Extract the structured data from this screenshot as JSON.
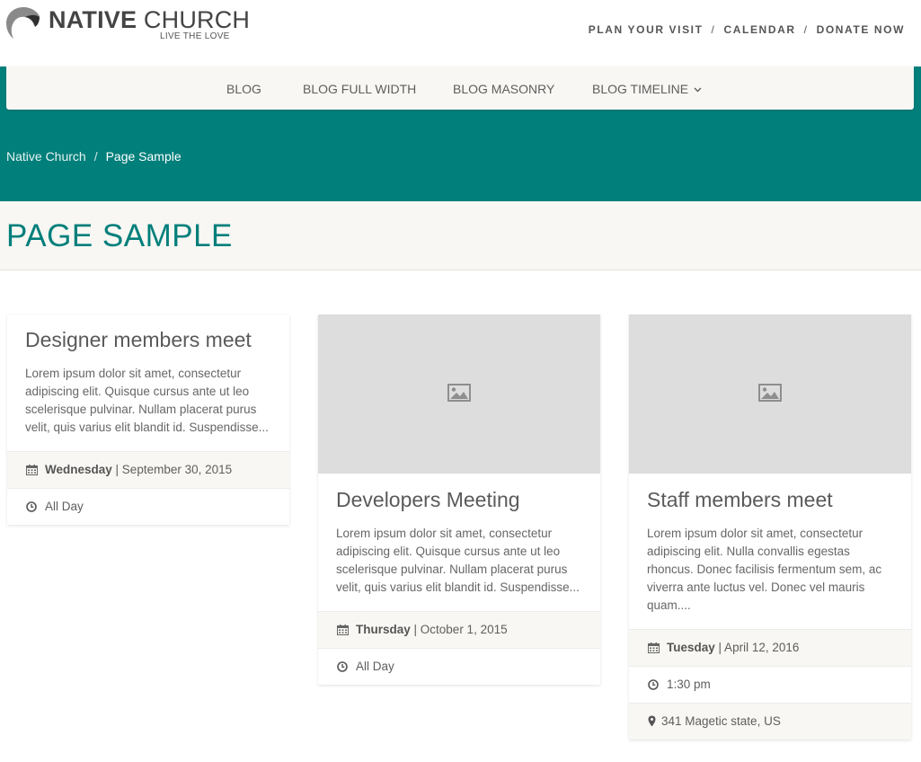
{
  "brand": {
    "name_bold": "NATIVE",
    "name_light": "CHURCH",
    "tagline": "LIVE THE LOVE"
  },
  "top_nav": {
    "items": [
      "PLAN YOUR VISIT",
      "CALENDAR",
      "DONATE NOW"
    ],
    "separator": "/"
  },
  "main_nav": {
    "items": [
      "BLOG",
      "BLOG FULL WIDTH",
      "BLOG MASONRY",
      "BLOG TIMELINE"
    ]
  },
  "breadcrumb": {
    "home": "Native Church",
    "separator": "/",
    "current": "Page Sample"
  },
  "page_title": "PAGE SAMPLE",
  "events": [
    {
      "title": "Designer members meet",
      "excerpt": "Lorem ipsum dolor sit amet, consectetur adipiscing elit. Quisque cursus ante ut leo scelerisque pulvinar. Nullam placerat purus velit, quis varius elit blandit id. Suspendisse...",
      "day": "Wednesday",
      "date": "| September 30, 2015",
      "time": "All Day"
    },
    {
      "title": "Developers Meeting",
      "excerpt": "Lorem ipsum dolor sit amet, consectetur adipiscing elit. Quisque cursus ante ut leo scelerisque pulvinar. Nullam placerat purus velit, quis varius elit blandit id. Suspendisse...",
      "day": "Thursday",
      "date": "| October 1, 2015",
      "time": "All Day"
    },
    {
      "title": "Staff members meet",
      "excerpt": "Lorem ipsum dolor sit amet, consectetur adipiscing elit. Nulla convallis egestas rhoncus. Donec facilisis fermentum sem, ac viverra ante luctus vel. Donec vel mauris quam....",
      "day": "Tuesday",
      "date": "| April 12, 2016",
      "time": "1:30 pm",
      "location": "341 Magetic state, US"
    }
  ],
  "colors": {
    "accent": "#007f7b",
    "light_band": "#f8f7f3",
    "image_placeholder": "#dddddd"
  }
}
